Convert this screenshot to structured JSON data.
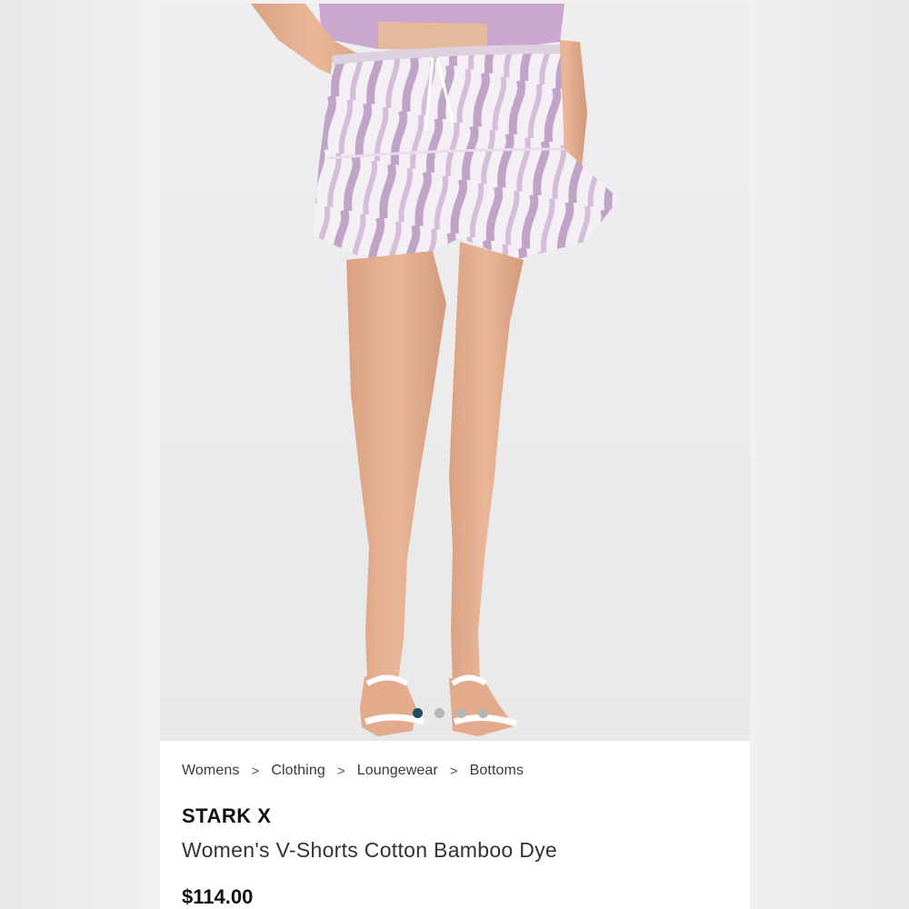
{
  "breadcrumb": {
    "items": [
      "Womens",
      "Clothing",
      "Loungewear",
      "Bottoms"
    ],
    "separator": ">"
  },
  "product": {
    "brand": "STARK X",
    "title": "Women's V-Shorts Cotton Bamboo Dye",
    "price": "$114.00"
  },
  "gallery": {
    "image_count": 4,
    "active_index": 0
  },
  "colors": {
    "active_dot": "#1f4a63",
    "inactive_dot": "#b9b5b3",
    "tie_dye_lilac": "#b896c0"
  }
}
